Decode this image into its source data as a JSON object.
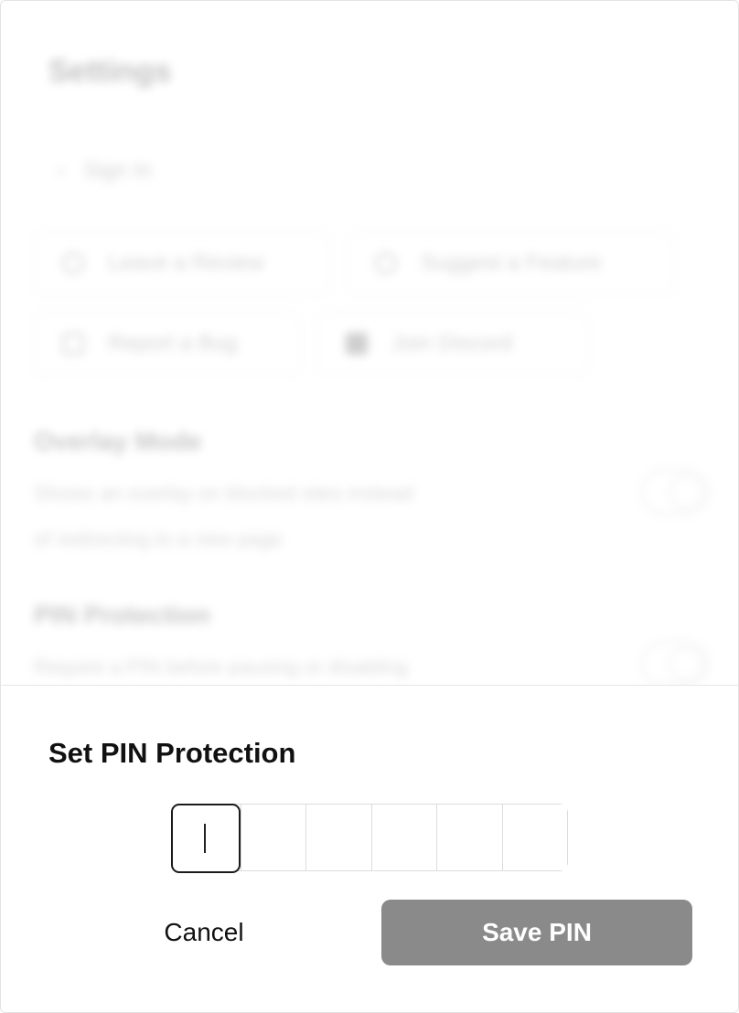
{
  "background": {
    "page_title": "Settings",
    "sign_in": "Sign In",
    "actions": [
      {
        "label": "Leave a Review",
        "icon": "star-icon"
      },
      {
        "label": "Suggest a Feature",
        "icon": "lightbulb-icon"
      },
      {
        "label": "Report a Bug",
        "icon": "bug-icon"
      },
      {
        "label": "Join Discord",
        "icon": "discord-icon"
      }
    ],
    "sections": [
      {
        "title": "Overlay Mode",
        "desc_line1": "Shows an overlay on blocked sites instead",
        "desc_line2": "of redirecting to a new page"
      },
      {
        "title": "PIN Protection",
        "desc_line1": "Require a PIN before pausing or disabling"
      }
    ]
  },
  "sheet": {
    "title": "Set PIN Protection",
    "pin_length": 6,
    "cancel_label": "Cancel",
    "save_label": "Save PIN",
    "save_color": "#8a8a8a"
  }
}
